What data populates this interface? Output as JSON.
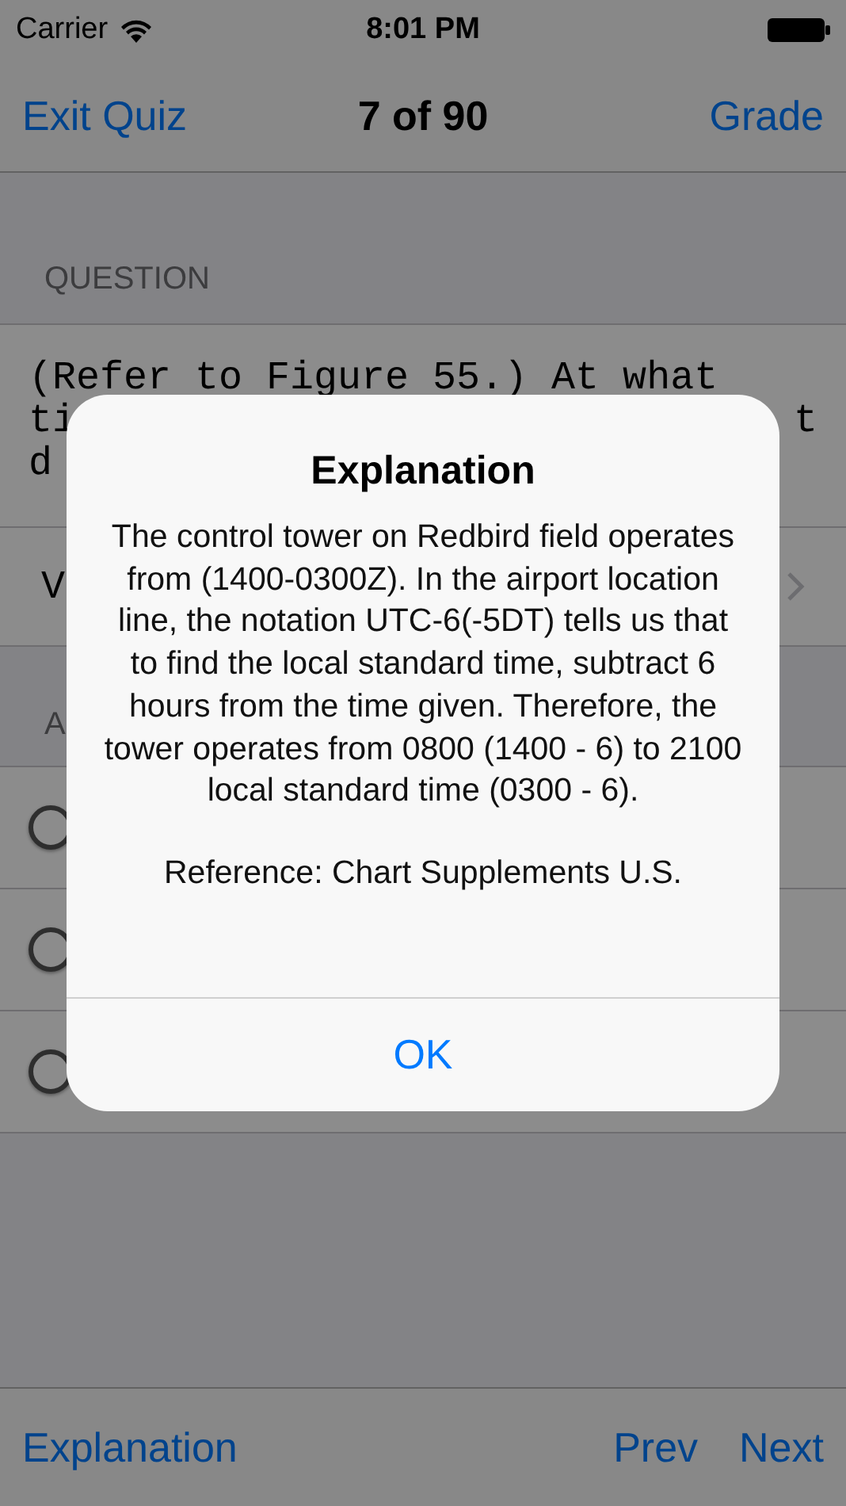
{
  "status_bar": {
    "carrier": "Carrier",
    "time": "8:01 PM"
  },
  "nav_bar": {
    "left": "Exit Quiz",
    "title": "7 of 90",
    "right": "Grade"
  },
  "question_section": {
    "header": "QUESTION",
    "lines": [
      {
        "left": "(Refer to Figure 55.) At what"
      },
      {
        "left": "ti",
        "right": "t"
      },
      {
        "left": "d"
      }
    ]
  },
  "view_row": {
    "label": "V"
  },
  "answers_section": {
    "header": "A",
    "answers": [
      {
        "selected": false
      },
      {
        "selected": false
      },
      {
        "selected": false
      }
    ]
  },
  "toolbar": {
    "left": "Explanation",
    "prev": "Prev",
    "next": "Next"
  },
  "alert": {
    "title": "Explanation",
    "message": "The control tower on Redbird field operates from (1400-0300Z). In the airport location line, the notation UTC-6(-5DT) tells us that to find the local standard time, subtract 6 hours from the time given. Therefore, the tower operates from 0800 (1400 - 6) to 2100 local standard time (0300 - 6).",
    "reference": "Reference: Chart Supplements U.S.",
    "button": "OK"
  }
}
